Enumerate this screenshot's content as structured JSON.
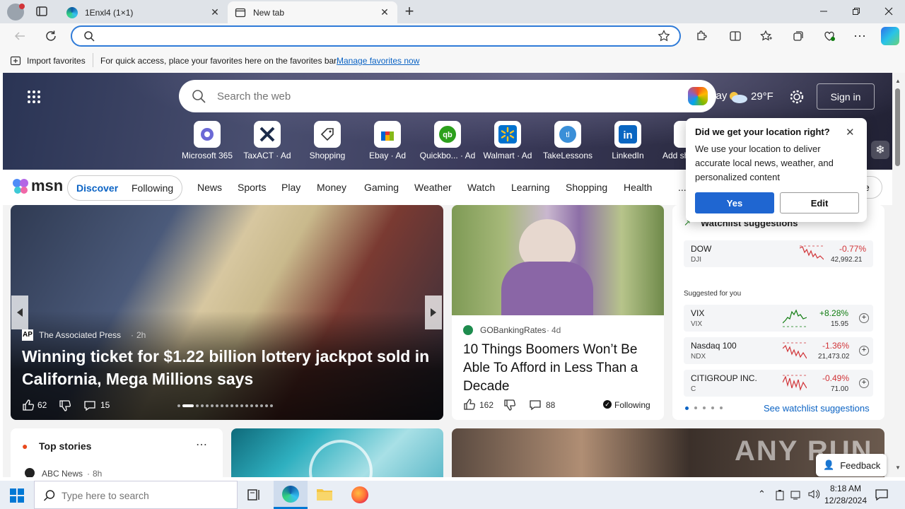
{
  "browser": {
    "tabs": [
      {
        "title": "1Enxl4 (1×1)"
      },
      {
        "title": "New tab"
      }
    ],
    "address_value": "",
    "favorites_bar": {
      "import_label": "Import favorites",
      "hint": "For quick access, place your favorites here on the favorites bar.",
      "manage_link": "Manage favorites now"
    }
  },
  "msn": {
    "search_placeholder": "Search the web",
    "weather_partial": "...ay",
    "temperature": "29°F",
    "sign_in": "Sign in",
    "quick_links": [
      {
        "label": "Microsoft 365"
      },
      {
        "label": "TaxACT · Ad"
      },
      {
        "label": "Shopping"
      },
      {
        "label": "Ebay · Ad"
      },
      {
        "label": "Quickbo... · Ad"
      },
      {
        "label": "Walmart · Ad"
      },
      {
        "label": "TakeLessons"
      },
      {
        "label": "LinkedIn"
      },
      {
        "label": "Add sh"
      }
    ],
    "logo": "msn",
    "nav_pills": [
      "Discover",
      "Following"
    ],
    "nav": [
      "News",
      "Sports",
      "Play",
      "Money",
      "Gaming",
      "Weather",
      "Watch",
      "Learning",
      "Shopping",
      "Health",
      "..."
    ],
    "personalize_partial": "ze",
    "main_story": {
      "source": "The Associated Press",
      "age": "2h",
      "headline": "Winning ticket for $1.22 billion lottery jackpot sold in California, Mega Millions says",
      "likes": "62",
      "comments": "15"
    },
    "second_story": {
      "source": "GOBankingRates",
      "age": "4d",
      "headline": "10 Things Boomers Won’t Be Able To Afford in Less Than a Decade",
      "likes": "162",
      "comments": "88",
      "following": "Following"
    },
    "watchlist": {
      "title": "Watchlist suggestions",
      "pinned": [
        {
          "name": "DOW",
          "ticker": "DJI",
          "change": "-0.77%",
          "price": "42,992.21",
          "color": "#d13438"
        }
      ],
      "suggested_label": "Suggested for you",
      "suggested": [
        {
          "name": "VIX",
          "ticker": "VIX",
          "change": "+8.28%",
          "price": "15.95",
          "color": "#107c10"
        },
        {
          "name": "Nasdaq 100",
          "ticker": "NDX",
          "change": "-1.36%",
          "price": "21,473.02",
          "color": "#d13438"
        },
        {
          "name": "CITIGROUP INC.",
          "ticker": "C",
          "change": "-0.49%",
          "price": "71.00",
          "color": "#d13438"
        }
      ],
      "see_more": "See watchlist suggestions"
    },
    "top_stories": {
      "title": "Top stories",
      "first_source": "ABC News",
      "first_age": "8h"
    },
    "feedback": "Feedback",
    "watermark": "ANY RUN"
  },
  "location_popup": {
    "title": "Did we get your location right?",
    "body": "We use your location to deliver accurate local news, weather, and personalized content",
    "yes": "Yes",
    "edit": "Edit"
  },
  "taskbar": {
    "search_placeholder": "Type here to search",
    "time": "8:18 AM",
    "date": "12/28/2024"
  }
}
